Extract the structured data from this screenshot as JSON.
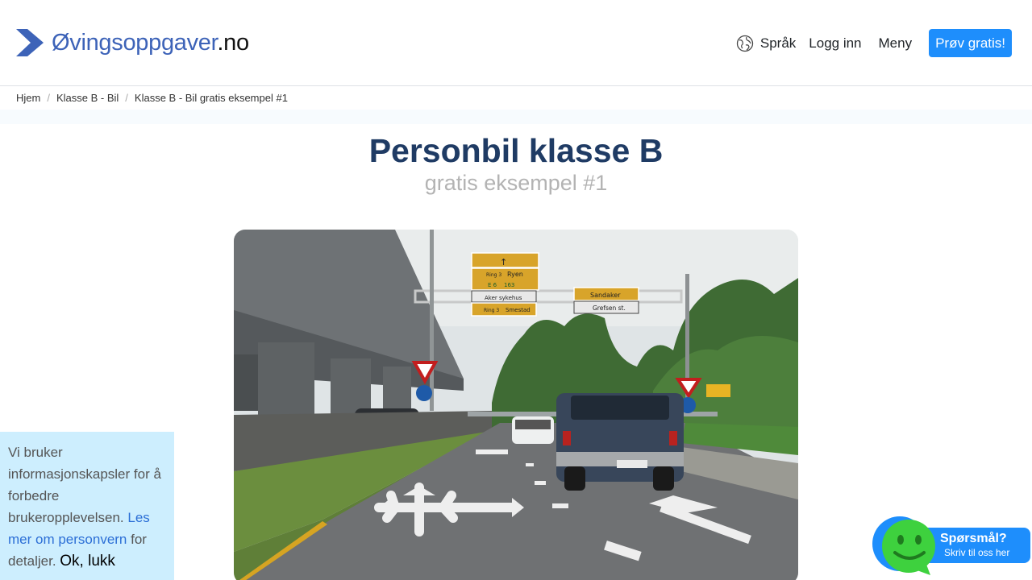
{
  "header": {
    "logo_main": "Øvingsoppgaver",
    "logo_tld": ".no",
    "nav": {
      "language": "Språk",
      "login": "Logg inn",
      "menu": "Meny",
      "cta": "Prøv gratis!"
    }
  },
  "breadcrumb": {
    "items": [
      "Hjem",
      "Klasse B - Bil"
    ],
    "current": "Klasse B - Bil gratis eksempel #1",
    "separator": "/"
  },
  "page": {
    "title": "Personbil klasse B",
    "subtitle": "gratis eksempel #1"
  },
  "question_image": {
    "signs": {
      "top_arrow": "",
      "ring_ryen_ring": "Ring 3",
      "ring_ryen_place": "Ryen",
      "e6": "E 6",
      "road_163": "163",
      "aker": "Aker sykehus",
      "smestad_ring": "Ring 3",
      "smestad": "Smestad",
      "sandaker": "Sandaker",
      "grefsen": "Grefsen st."
    }
  },
  "cookie": {
    "text_before": "Vi bruker informasjonskapsler for å forbedre brukeropplevelsen. ",
    "link": "Les mer om personvern",
    "text_after": " for detaljer. ",
    "ok": "Ok, lukk"
  },
  "chat": {
    "title": "Spørsmål?",
    "subtitle": "Skriv til oss her"
  },
  "colors": {
    "brand_blue": "#3d63b8",
    "cta_blue": "#1e8efc",
    "title_navy": "#1f3b64",
    "cookie_bg": "#cdeefe",
    "chat_green": "#3ed13e"
  }
}
